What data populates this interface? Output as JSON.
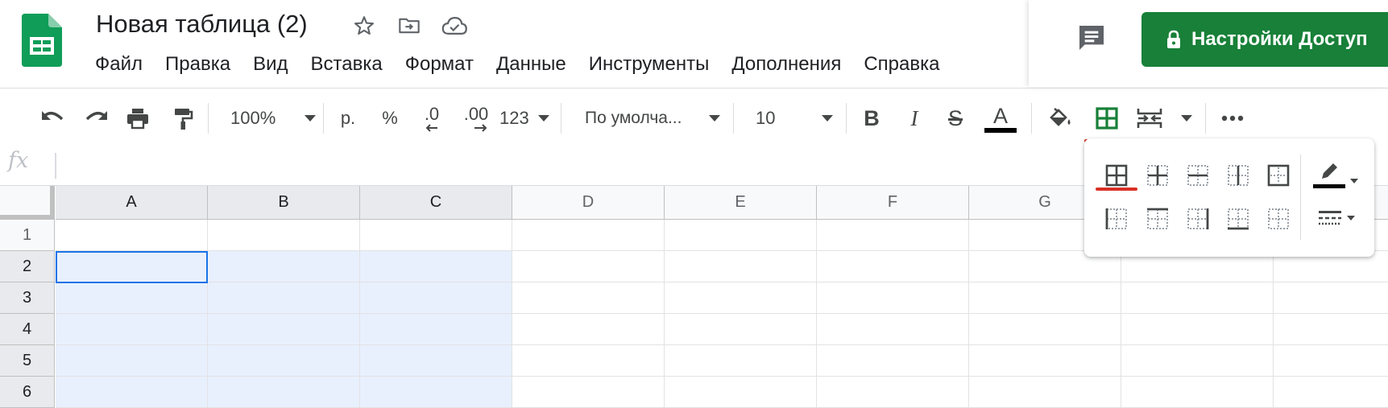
{
  "app": {
    "document_title": "Новая таблица (2)"
  },
  "menu": {
    "items": [
      {
        "label": "Файл"
      },
      {
        "label": "Правка"
      },
      {
        "label": "Вид"
      },
      {
        "label": "Вставка"
      },
      {
        "label": "Формат"
      },
      {
        "label": "Данные"
      },
      {
        "label": "Инструменты"
      },
      {
        "label": "Дополнения"
      },
      {
        "label": "Справка"
      }
    ]
  },
  "share": {
    "label": "Настройки Доступ"
  },
  "toolbar": {
    "zoom": "100%",
    "currency": "р.",
    "percent": "%",
    "decrease_decimals": ".0",
    "increase_decimals": ".00",
    "more_formats": "123",
    "font_family": "По умолча...",
    "font_size": "10",
    "bold": "B",
    "italic": "I",
    "strikethrough": "S",
    "text_color": "A"
  },
  "formula_bar": {
    "fx": "fx",
    "value": ""
  },
  "grid": {
    "columns": [
      "A",
      "B",
      "C",
      "D",
      "E",
      "F",
      "G"
    ],
    "rows": [
      "1",
      "2",
      "3",
      "4",
      "5",
      "6"
    ]
  },
  "colors": {
    "accent_green": "#188038",
    "selection_fill": "#e8f0fe",
    "active_border": "#1a73e8",
    "active_tool_underline": "#d93025"
  }
}
